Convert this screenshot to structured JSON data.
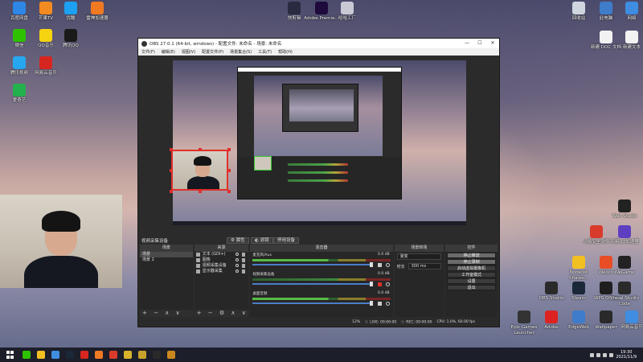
{
  "desktop": {
    "left_icons": [
      {
        "label": "百度网盘",
        "color": "#2e87e6"
      },
      {
        "label": "芒果TV",
        "color": "#f38b21"
      },
      {
        "label": "优酷",
        "color": "#1da1f2"
      },
      {
        "label": "雷神加速器",
        "color": "#f07a22"
      },
      {
        "label": "微信",
        "color": "#2dc100"
      },
      {
        "label": "QQ音乐",
        "color": "#f5d311"
      },
      {
        "label": "腾讯QQ",
        "color": "#1a1a1a"
      },
      {
        "label": "腾讯视频",
        "color": "#27a7f0"
      },
      {
        "label": "网易云音乐",
        "color": "#d7251f"
      },
      {
        "label": "爱奇艺",
        "color": "#22b14c"
      }
    ],
    "top_icons": [
      {
        "label": "快剪辑",
        "color": "#2a2a40"
      },
      {
        "label": "Adobe Premie...",
        "color": "#1e0a3c"
      },
      {
        "label": "哈哈工厂",
        "color": "#c9c9d6"
      }
    ],
    "right_icons": [
      {
        "label": "回收站",
        "color": "#cfd6e0"
      },
      {
        "label": "此电脑",
        "color": "#3f7cc9"
      },
      {
        "label": "网络",
        "color": "#3f8de0"
      },
      {
        "label": "新建 DOC 文档",
        "color": "#f2f2f2"
      },
      {
        "label": "新建文本",
        "color": "#f2f2f2"
      },
      {
        "label": "Wall Studio",
        "color": "#222"
      },
      {
        "label": "火绒安全软件",
        "color": "#d83b2b"
      },
      {
        "label": "网易UU加速器",
        "color": "#5e3fc2"
      },
      {
        "label": "Nodelist Shares...",
        "color": "#f3c022"
      },
      {
        "label": "Weiyin",
        "color": "#e84d26"
      },
      {
        "label": "WeGame",
        "color": "#222"
      },
      {
        "label": "OBS Studio",
        "color": "#2a2a2a"
      },
      {
        "label": "Steam",
        "color": "#1b2838"
      },
      {
        "label": "WPS Office",
        "color": "#1e1e1e"
      },
      {
        "label": "Visual Studio Code",
        "color": "#2a2a2a"
      },
      {
        "label": "Epic Games Launcher",
        "color": "#333"
      },
      {
        "label": "Adobe",
        "color": "#d22"
      },
      {
        "label": "EdgeWeb",
        "color": "#3f7cc9"
      },
      {
        "label": "Wallpaper",
        "color": "#2a2a2a"
      },
      {
        "label": "网易云音乐",
        "color": "#3f8de0"
      }
    ]
  },
  "obs": {
    "title": "OBS 27.0.1 (64-bit, windows) - 配置文件: 未命名 - 场景: 未命名",
    "window_buttons": {
      "minimize": "—",
      "maximize": "☐",
      "close": "✕"
    },
    "menu": [
      "文件(F)",
      "编辑(E)",
      "视图(V)",
      "配置文件(P)",
      "场景集合(S)",
      "工具(T)",
      "帮助(H)"
    ],
    "source_bar": {
      "selected_source": "视频采集设备",
      "properties_label": "属性",
      "filters_label": "滤镜",
      "activate_label": "停用设备"
    },
    "scenes": {
      "header": "场景",
      "items": [
        "场景",
        "场景 2"
      ],
      "selected_index": 0,
      "footer": "+ − ∧ ∨"
    },
    "sources": {
      "header": "来源",
      "items": [
        "文本 (GDI+)",
        "图像",
        "视频采集设备",
        "显示器采集"
      ],
      "footer": "+ − ⚙ ∧ ∨"
    },
    "mixer": {
      "header": "混音器",
      "channels": [
        {
          "name": "麦克风/Aux",
          "db": "0.0 dB",
          "muted": false
        },
        {
          "name": "视频采集设备",
          "db": "0.0 dB",
          "muted": true
        },
        {
          "name": "桌面音频",
          "db": "0.0 dB",
          "muted": false
        }
      ]
    },
    "transitions": {
      "header": "场景转场",
      "type": "渐变",
      "duration_label": "时长",
      "duration_value": "300 ms"
    },
    "controls": {
      "header": "控件",
      "buttons": [
        "停止推流",
        "停止录制",
        "启动虚拟摄像机",
        "工作室模式",
        "设置",
        "退出"
      ]
    },
    "status": {
      "live": "LIVE: 00:00:00",
      "rec": "REC: 00:00:00",
      "cpu": "CPU: 1.0%, 60.00 fps",
      "dropped": "12%"
    }
  },
  "taskbar": {
    "apps": [
      {
        "name": "wechat",
        "color": "#2dc100"
      },
      {
        "name": "folder",
        "color": "#f3c022"
      },
      {
        "name": "edge",
        "color": "#3f8de0"
      },
      {
        "name": "steam",
        "color": "#1b2838"
      },
      {
        "name": "netease",
        "color": "#d7251f"
      },
      {
        "name": "lightning",
        "color": "#f07a22"
      },
      {
        "name": "wps",
        "color": "#d83b2b"
      },
      {
        "name": "weiyin",
        "color": "#d8b32b"
      },
      {
        "name": "tools",
        "color": "#c9a22b"
      },
      {
        "name": "obs",
        "color": "#2a2a2a"
      },
      {
        "name": "epic",
        "color": "#c9871e"
      }
    ],
    "time": "19:30",
    "date": "2021/11/9"
  }
}
